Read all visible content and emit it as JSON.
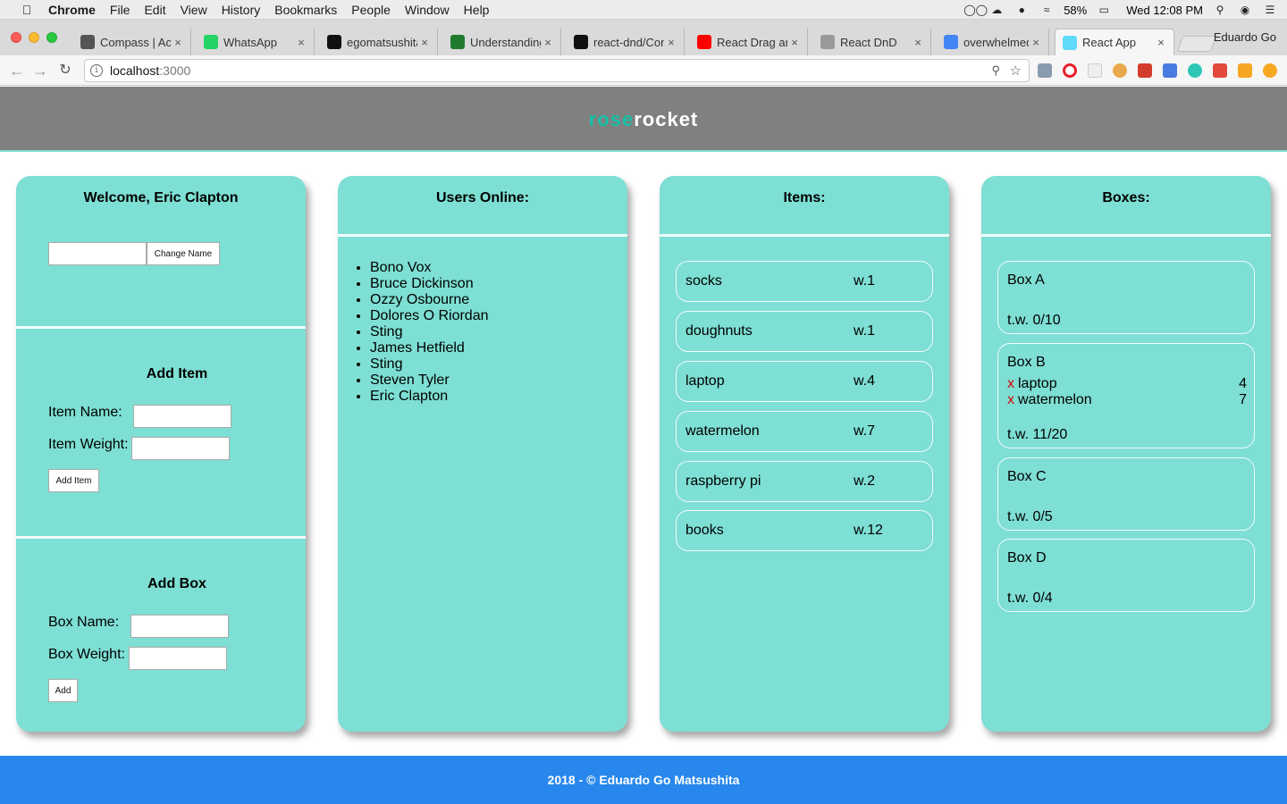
{
  "menubar": {
    "app": "Chrome",
    "items": [
      "File",
      "Edit",
      "View",
      "History",
      "Bookmarks",
      "People",
      "Window",
      "Help"
    ],
    "battery": "58%",
    "clock": "Wed 12:08 PM"
  },
  "tabs": [
    {
      "label": "Compass | Acc",
      "favicon": "compass-icon",
      "color": "#555555"
    },
    {
      "label": "WhatsApp",
      "favicon": "whatsapp-icon",
      "color": "#25d366"
    },
    {
      "label": "egomatsushita",
      "favicon": "github-icon",
      "color": "#111111"
    },
    {
      "label": "Understanding",
      "favicon": "spreadsheet-icon",
      "color": "#1f7a2e"
    },
    {
      "label": "react-dnd/Con",
      "favicon": "github-icon",
      "color": "#111111"
    },
    {
      "label": "React Drag an",
      "favicon": "youtube-icon",
      "color": "#ff0000"
    },
    {
      "label": "React DnD",
      "favicon": "document-icon",
      "color": "#999999"
    },
    {
      "label": "overwhelmed",
      "favicon": "google-icon",
      "color": "#4285f4"
    },
    {
      "label": "React App",
      "favicon": "react-icon",
      "color": "#61dafb",
      "active": true
    }
  ],
  "profile_name": "Eduardo Go",
  "address": {
    "host": "localhost",
    "port": ":3000"
  },
  "brand": {
    "part1": "rose",
    "part2": "rocket"
  },
  "welcome_card": {
    "title": "Welcome, Eric Clapton",
    "name_input_value": "",
    "change_name_label": "Change Name"
  },
  "add_item": {
    "title": "Add Item",
    "name_label": "Item Name:",
    "weight_label": "Item Weight:",
    "button": "Add Item"
  },
  "add_box": {
    "title": "Add Box",
    "name_label": "Box Name:",
    "weight_label": "Box Weight:",
    "button": "Add"
  },
  "users_card": {
    "title": "Users Online:",
    "users": [
      "Bono Vox",
      "Bruce Dickinson",
      "Ozzy Osbourne",
      "Dolores O Riordan",
      "Sting",
      "James Hetfield",
      "Sting",
      "Steven Tyler",
      "Eric Clapton"
    ]
  },
  "items_card": {
    "title": "Items:",
    "items": [
      {
        "name": "socks",
        "weight": "w.1"
      },
      {
        "name": "doughnuts",
        "weight": "w.1"
      },
      {
        "name": "laptop",
        "weight": "w.4"
      },
      {
        "name": "watermelon",
        "weight": "w.7"
      },
      {
        "name": "raspberry pi",
        "weight": "w.2"
      },
      {
        "name": "books",
        "weight": "w.12"
      }
    ]
  },
  "boxes_card": {
    "title": "Boxes:",
    "remove_mark": "x",
    "boxes": [
      {
        "name": "Box A",
        "items": [],
        "total": "t.w. 0/10"
      },
      {
        "name": "Box B",
        "items": [
          {
            "name": "laptop",
            "weight": "4"
          },
          {
            "name": "watermelon",
            "weight": "7"
          }
        ],
        "total": "t.w. 11/20"
      },
      {
        "name": "Box C",
        "items": [],
        "total": "t.w. 0/5"
      },
      {
        "name": "Box D",
        "items": [],
        "total": "t.w. 0/4"
      }
    ]
  },
  "footer": "2018 - © Eduardo Go Matsushita",
  "colors": {
    "card": "#7edfd4",
    "header": "#808080",
    "brand_accent": "#16c0a8",
    "footer": "#2787ec",
    "remove": "#e00000"
  }
}
